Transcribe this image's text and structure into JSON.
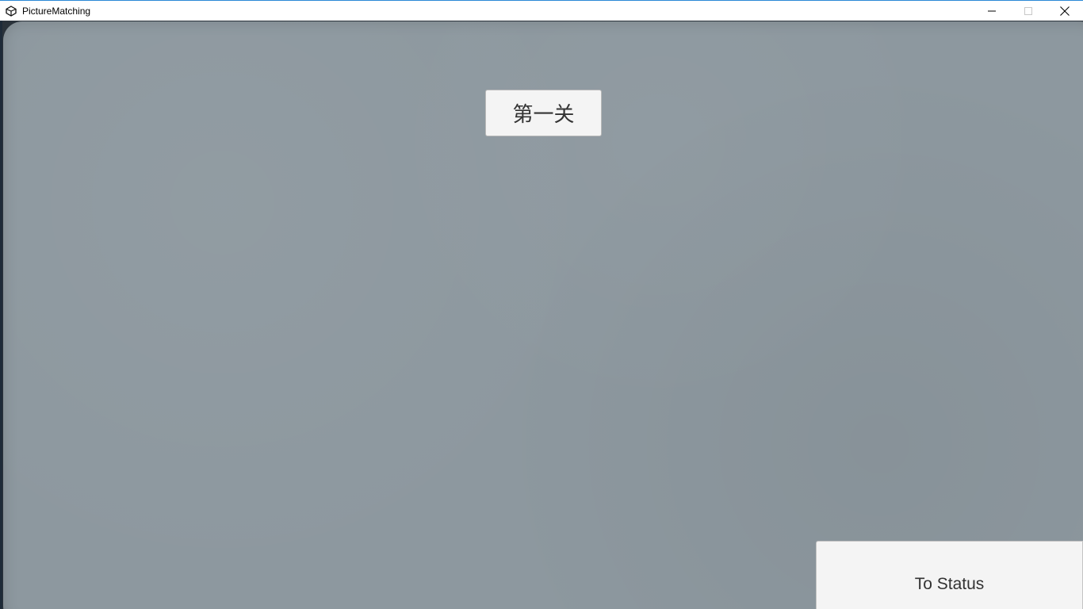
{
  "window": {
    "title": "PictureMatching",
    "app_icon": "unity-icon",
    "controls": {
      "minimize_icon": "minimize-icon",
      "maximize_icon": "maximize-icon",
      "close_icon": "close-icon"
    }
  },
  "game": {
    "level_button_label": "第一关",
    "status_button_label": "To Status",
    "background_color": "#8d989f"
  }
}
